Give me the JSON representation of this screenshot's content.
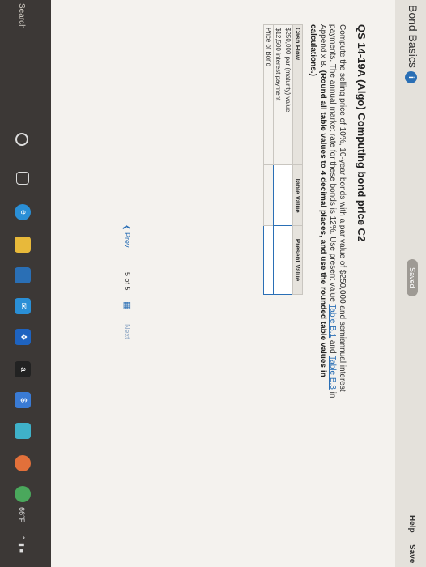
{
  "header": {
    "title": "Bond Basics",
    "info_icon": "i",
    "saved": "Saved",
    "help": "Help",
    "save": "Save"
  },
  "question": {
    "heading": "QS 14-19A (Algo) Computing bond price C2",
    "text_1": "Compute the selling price of 10%, 10-year bonds with a par value of $250,000 and semiannual interest payments. The annual market rate for these bonds is 12%. Use present value ",
    "link_1": "Table B.1",
    "text_2": " and ",
    "link_2": "Table B.3",
    "text_3": " in Appendix B. ",
    "bold_text": "(Round all table values to 4 decimal places, and use the rounded table values in calculations.)"
  },
  "table": {
    "headers": [
      "Cash Flow",
      "Table Value",
      "Present Value"
    ],
    "rows": [
      {
        "label": "$250,000 par (maturity) value",
        "table_value": "",
        "present_value": ""
      },
      {
        "label": "$12,500 interest payment",
        "table_value": "",
        "present_value": ""
      },
      {
        "label": "Price of Bond",
        "table_value": "",
        "present_value": ""
      }
    ]
  },
  "pager": {
    "prev": "Prev",
    "count": "5 of 5",
    "next": "Next"
  },
  "taskbar": {
    "search": "Search",
    "temperature": "66°F"
  },
  "colors": {
    "accent": "#2a6fb5",
    "taskbar": "#3c3836"
  }
}
